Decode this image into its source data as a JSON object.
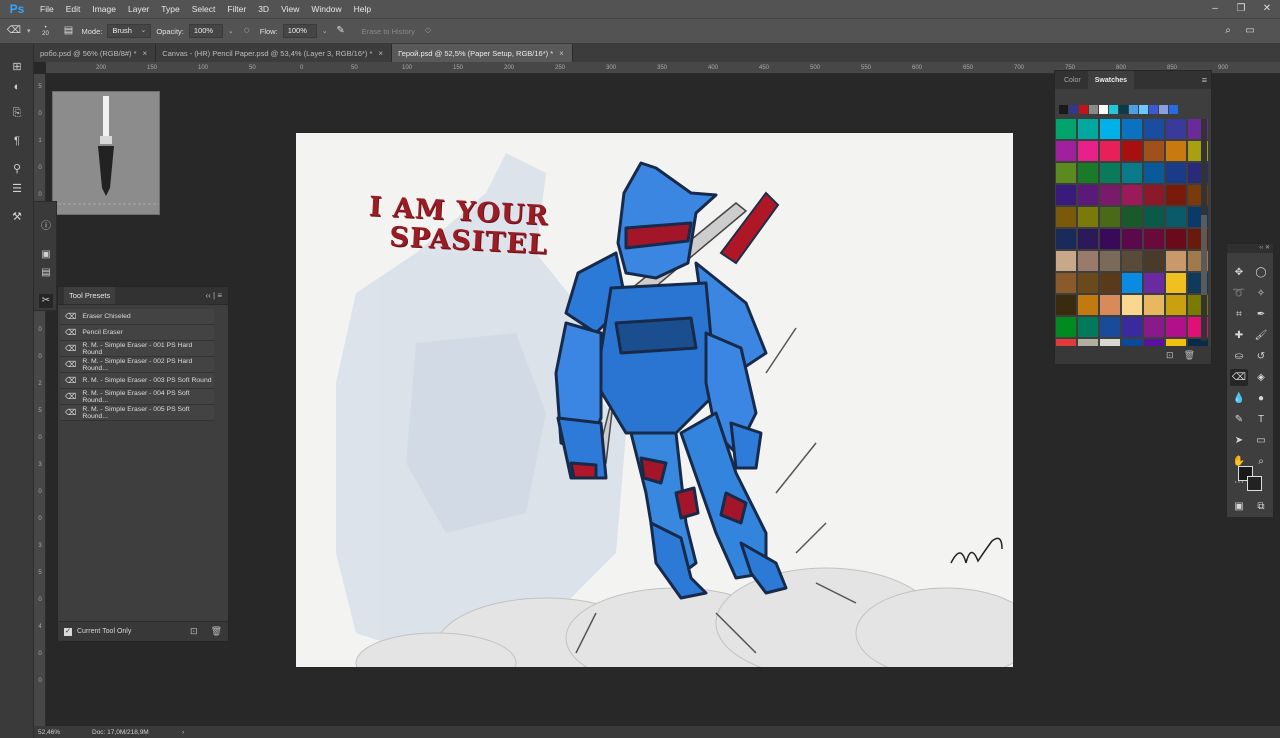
{
  "app": {
    "logo": "Ps"
  },
  "menu": [
    "File",
    "Edit",
    "Image",
    "Layer",
    "Type",
    "Select",
    "Filter",
    "3D",
    "View",
    "Window",
    "Help"
  ],
  "window_controls": [
    "–",
    "❐",
    "✕"
  ],
  "options": {
    "brush_size": "20",
    "mode_label": "Mode:",
    "mode_value": "Brush",
    "opacity_label": "Opacity:",
    "opacity_value": "100%",
    "flow_label": "Flow:",
    "flow_value": "100%",
    "erase_history": "Erase to History"
  },
  "tabs": [
    {
      "label": "робо.psd @ 56% (RGB/8#) *",
      "active": false
    },
    {
      "label": "Canvas - (HR) Pencil Paper.psd @ 53,4% (Layer 3, RGB/16*) *",
      "active": false
    },
    {
      "label": "Герой.psd @ 52,5% (Paper Setup, RGB/16*) *",
      "active": true
    }
  ],
  "ruler_top": [
    "200",
    "150",
    "100",
    "50",
    "0",
    "50",
    "100",
    "150",
    "200",
    "250",
    "300",
    "350",
    "400",
    "450",
    "500",
    "550",
    "600",
    "650",
    "700",
    "750",
    "800",
    "850",
    "900"
  ],
  "ruler_left": [
    "5",
    "0",
    "1",
    "0",
    "0",
    "1",
    "5",
    "0",
    "2",
    "0",
    "0",
    "2",
    "5",
    "0",
    "3",
    "0",
    "0",
    "3",
    "5",
    "0",
    "4",
    "0",
    "0"
  ],
  "tool_presets": {
    "title": "Tool Presets",
    "items": [
      "Eraser Chiseled",
      "Pencil Eraser",
      "R. M. - Simple Eraser - 001 PS Hard Round",
      "R. M. - Simple Eraser - 002 PS Hard Round...",
      "R. M. - Simple Eraser - 003 PS Soft Round",
      "R. M. - Simple Eraser - 004 PS Soft Round...",
      "R. M. - Simple Eraser - 005 PS Soft Round..."
    ],
    "footer_label": "Current Tool Only"
  },
  "swatches": {
    "tab_color": "Color",
    "tab_swatches": "Swatches",
    "recent": [
      "#1a1a1a",
      "#2f3a8f",
      "#c2121b",
      "#8a8a8a",
      "#ffffff",
      "#25c6dc",
      "#0b3a4a",
      "#4aa0e0",
      "#6ec6ff",
      "#3a5ad0",
      "#8a9ee0",
      "#2a6ae0"
    ],
    "grid": [
      "#00a36c",
      "#00a8a0",
      "#00b0e8",
      "#0a72c0",
      "#1a4ca0",
      "#3a3a9a",
      "#6a2a9a",
      "#a020a0",
      "#e8208a",
      "#e8205a",
      "#a81010",
      "#a0501a",
      "#c87a10",
      "#a8a010",
      "#5a8a20",
      "#1a7a2a",
      "#0a7a5a",
      "#0a7a8a",
      "#0a5a9a",
      "#1a3a8a",
      "#2a2a7a",
      "#3a1a7a",
      "#5a1a7a",
      "#7a1a6a",
      "#9a1a5a",
      "#8a1a2a",
      "#7a1a0a",
      "#7a3a0a",
      "#7a5a0a",
      "#7a7a0a",
      "#4a6a1a",
      "#1a5a2a",
      "#0a5a4a",
      "#0a5a6a",
      "#0a3a6a",
      "#1a2a5a",
      "#2a1a5a",
      "#3a0a5a",
      "#5a0a4a",
      "#6a0a3a",
      "#6a0a1a",
      "#6a1a0a",
      "#c8a888",
      "#9a7a6a",
      "#7a6a5a",
      "#5a4a3a",
      "#4a3a2a",
      "#c89a6a",
      "#a07a4a",
      "#8a5a2a",
      "#6a4a1a",
      "#5a3a1a",
      "#0a8ae0",
      "#6a2aa0",
      "#f0c020",
      "#103a5a",
      "#3a2a10",
      "#c07a10",
      "#d88a5a",
      "#f8d890",
      "#e8b860",
      "#c8a010",
      "#7a7a00",
      "#008a20",
      "#007a5a",
      "#1a4a9a",
      "#3a2aa0",
      "#8a1a8a",
      "#b0108a",
      "#e01078",
      "#e03a3a",
      "#b0b0a0",
      "#d8d8d0",
      "#0a4a9a",
      "#5a10a0",
      "#f0c010",
      "#0a2a4a"
    ]
  },
  "artwork": {
    "title_line1": "I AM YOUR",
    "title_line2": "SPASITEL"
  },
  "status": {
    "zoom": "52,46%",
    "doc": "Doc: 17,0M/218,9M",
    "arrow": "›"
  }
}
